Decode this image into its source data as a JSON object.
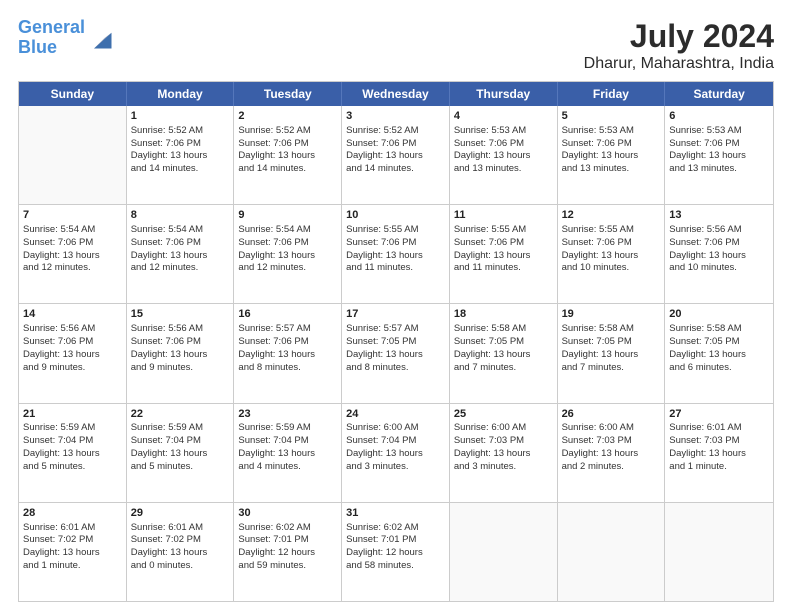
{
  "header": {
    "logo_line1": "General",
    "logo_line2": "Blue",
    "main_title": "July 2024",
    "sub_title": "Dharur, Maharashtra, India"
  },
  "days_of_week": [
    "Sunday",
    "Monday",
    "Tuesday",
    "Wednesday",
    "Thursday",
    "Friday",
    "Saturday"
  ],
  "weeks": [
    [
      {
        "day": "",
        "info": ""
      },
      {
        "day": "1",
        "info": "Sunrise: 5:52 AM\nSunset: 7:06 PM\nDaylight: 13 hours\nand 14 minutes."
      },
      {
        "day": "2",
        "info": "Sunrise: 5:52 AM\nSunset: 7:06 PM\nDaylight: 13 hours\nand 14 minutes."
      },
      {
        "day": "3",
        "info": "Sunrise: 5:52 AM\nSunset: 7:06 PM\nDaylight: 13 hours\nand 14 minutes."
      },
      {
        "day": "4",
        "info": "Sunrise: 5:53 AM\nSunset: 7:06 PM\nDaylight: 13 hours\nand 13 minutes."
      },
      {
        "day": "5",
        "info": "Sunrise: 5:53 AM\nSunset: 7:06 PM\nDaylight: 13 hours\nand 13 minutes."
      },
      {
        "day": "6",
        "info": "Sunrise: 5:53 AM\nSunset: 7:06 PM\nDaylight: 13 hours\nand 13 minutes."
      }
    ],
    [
      {
        "day": "7",
        "info": "Sunrise: 5:54 AM\nSunset: 7:06 PM\nDaylight: 13 hours\nand 12 minutes."
      },
      {
        "day": "8",
        "info": "Sunrise: 5:54 AM\nSunset: 7:06 PM\nDaylight: 13 hours\nand 12 minutes."
      },
      {
        "day": "9",
        "info": "Sunrise: 5:54 AM\nSunset: 7:06 PM\nDaylight: 13 hours\nand 12 minutes."
      },
      {
        "day": "10",
        "info": "Sunrise: 5:55 AM\nSunset: 7:06 PM\nDaylight: 13 hours\nand 11 minutes."
      },
      {
        "day": "11",
        "info": "Sunrise: 5:55 AM\nSunset: 7:06 PM\nDaylight: 13 hours\nand 11 minutes."
      },
      {
        "day": "12",
        "info": "Sunrise: 5:55 AM\nSunset: 7:06 PM\nDaylight: 13 hours\nand 10 minutes."
      },
      {
        "day": "13",
        "info": "Sunrise: 5:56 AM\nSunset: 7:06 PM\nDaylight: 13 hours\nand 10 minutes."
      }
    ],
    [
      {
        "day": "14",
        "info": "Sunrise: 5:56 AM\nSunset: 7:06 PM\nDaylight: 13 hours\nand 9 minutes."
      },
      {
        "day": "15",
        "info": "Sunrise: 5:56 AM\nSunset: 7:06 PM\nDaylight: 13 hours\nand 9 minutes."
      },
      {
        "day": "16",
        "info": "Sunrise: 5:57 AM\nSunset: 7:06 PM\nDaylight: 13 hours\nand 8 minutes."
      },
      {
        "day": "17",
        "info": "Sunrise: 5:57 AM\nSunset: 7:05 PM\nDaylight: 13 hours\nand 8 minutes."
      },
      {
        "day": "18",
        "info": "Sunrise: 5:58 AM\nSunset: 7:05 PM\nDaylight: 13 hours\nand 7 minutes."
      },
      {
        "day": "19",
        "info": "Sunrise: 5:58 AM\nSunset: 7:05 PM\nDaylight: 13 hours\nand 7 minutes."
      },
      {
        "day": "20",
        "info": "Sunrise: 5:58 AM\nSunset: 7:05 PM\nDaylight: 13 hours\nand 6 minutes."
      }
    ],
    [
      {
        "day": "21",
        "info": "Sunrise: 5:59 AM\nSunset: 7:04 PM\nDaylight: 13 hours\nand 5 minutes."
      },
      {
        "day": "22",
        "info": "Sunrise: 5:59 AM\nSunset: 7:04 PM\nDaylight: 13 hours\nand 5 minutes."
      },
      {
        "day": "23",
        "info": "Sunrise: 5:59 AM\nSunset: 7:04 PM\nDaylight: 13 hours\nand 4 minutes."
      },
      {
        "day": "24",
        "info": "Sunrise: 6:00 AM\nSunset: 7:04 PM\nDaylight: 13 hours\nand 3 minutes."
      },
      {
        "day": "25",
        "info": "Sunrise: 6:00 AM\nSunset: 7:03 PM\nDaylight: 13 hours\nand 3 minutes."
      },
      {
        "day": "26",
        "info": "Sunrise: 6:00 AM\nSunset: 7:03 PM\nDaylight: 13 hours\nand 2 minutes."
      },
      {
        "day": "27",
        "info": "Sunrise: 6:01 AM\nSunset: 7:03 PM\nDaylight: 13 hours\nand 1 minute."
      }
    ],
    [
      {
        "day": "28",
        "info": "Sunrise: 6:01 AM\nSunset: 7:02 PM\nDaylight: 13 hours\nand 1 minute."
      },
      {
        "day": "29",
        "info": "Sunrise: 6:01 AM\nSunset: 7:02 PM\nDaylight: 13 hours\nand 0 minutes."
      },
      {
        "day": "30",
        "info": "Sunrise: 6:02 AM\nSunset: 7:01 PM\nDaylight: 12 hours\nand 59 minutes."
      },
      {
        "day": "31",
        "info": "Sunrise: 6:02 AM\nSunset: 7:01 PM\nDaylight: 12 hours\nand 58 minutes."
      },
      {
        "day": "",
        "info": ""
      },
      {
        "day": "",
        "info": ""
      },
      {
        "day": "",
        "info": ""
      }
    ]
  ]
}
